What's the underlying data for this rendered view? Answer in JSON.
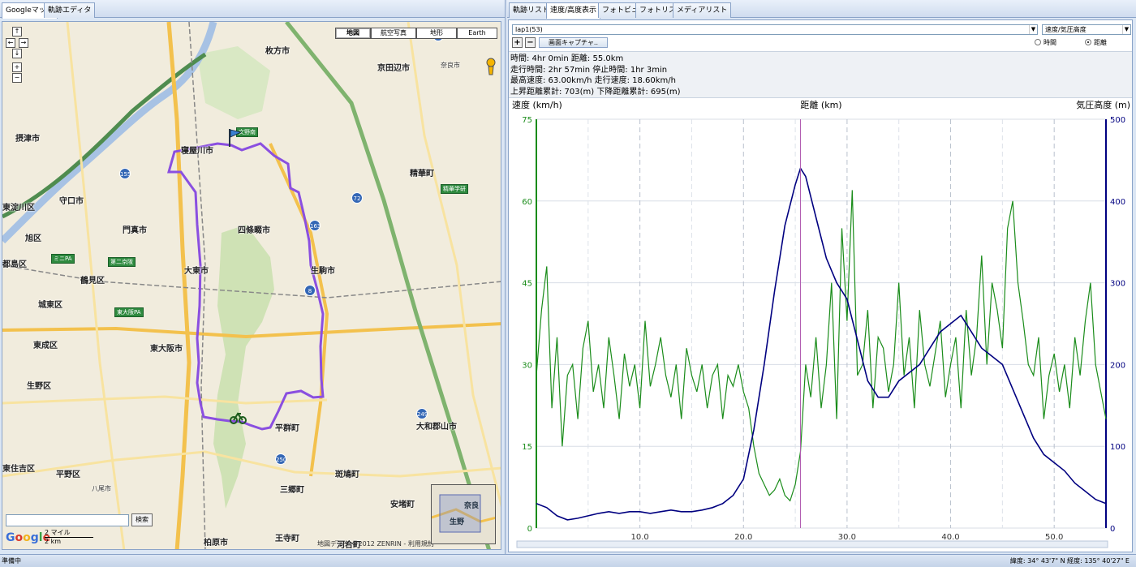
{
  "left_tabs": [
    "Googleマップ",
    "軌跡エディタ"
  ],
  "right_tabs": [
    "軌跡リスト",
    "速度/高度表示",
    "フォトビュー",
    "フォトリスト",
    "メディアリスト"
  ],
  "map": {
    "types": [
      "地図",
      "航空写真",
      "地形",
      "Earth"
    ],
    "search_button": "検索",
    "google_logo": "Google",
    "scale": {
      "top": "2 マイル",
      "bottom": "2 km"
    },
    "copyright": "地図データ ©2012 ZENRIN - 利用規約",
    "overview_labels": [
      "奈良",
      "生野"
    ],
    "places": [
      {
        "text": "枚方市"
      },
      {
        "text": "京田辺市"
      },
      {
        "text": "寝屋川市"
      },
      {
        "text": "摂津市"
      },
      {
        "text": "守口市"
      },
      {
        "text": "門真市"
      },
      {
        "text": "四條畷市"
      },
      {
        "text": "精華町"
      },
      {
        "text": "大東市"
      },
      {
        "text": "生駒市"
      },
      {
        "text": "鶴見区"
      },
      {
        "text": "城東区"
      },
      {
        "text": "東成区"
      },
      {
        "text": "東大阪市"
      },
      {
        "text": "生野区"
      },
      {
        "text": "平群町"
      },
      {
        "text": "大和郡山市"
      },
      {
        "text": "平野区"
      },
      {
        "text": "東住吉区"
      },
      {
        "text": "三郷町"
      },
      {
        "text": "斑鳩町"
      },
      {
        "text": "安堵町"
      },
      {
        "text": "柏原市"
      },
      {
        "text": "王寺町"
      },
      {
        "text": "河合町"
      },
      {
        "text": "旭区"
      },
      {
        "text": "東淀川区"
      },
      {
        "text": "都島区"
      },
      {
        "text": "八尾市"
      },
      {
        "text": "奈良市"
      }
    ]
  },
  "panel": {
    "track_select": "lap1(53)",
    "axis_select": "速度/気圧高度",
    "capture_button": "画面キャプチャ..",
    "radio_time": "時間",
    "radio_distance": "距離",
    "stats": [
      "時間: 4hr 0min  距離: 55.0km",
      "走行時間: 2hr 57min  停止時間: 1hr 3min",
      "最高速度: 63.00km/h  走行速度: 18.60km/h",
      "上昇距離累計: 703(m)  下降距離累計: 695(m)"
    ]
  },
  "chart_data": {
    "type": "line",
    "xlabel": "距離 (km)",
    "ylabel_left": "速度 (km/h)",
    "ylabel_right": "気圧高度 (m)",
    "x_ticks": [
      10.0,
      20.0,
      30.0,
      40.0,
      50.0
    ],
    "left_ticks": [
      0,
      15,
      30,
      45,
      60,
      75
    ],
    "right_ticks": [
      0,
      100,
      200,
      300,
      400,
      500
    ],
    "xlim": [
      0,
      55
    ],
    "ylim_left": [
      0,
      75
    ],
    "ylim_right": [
      0,
      500
    ],
    "cursor_x": 25.5,
    "colors": {
      "speed": "#1a8c1a",
      "altitude": "#000080",
      "cursor": "#b05ab0",
      "left_axis": "#1a8c1a",
      "right_axis": "#000080"
    },
    "series": [
      {
        "name": "速度",
        "axis": "left",
        "x": [
          0,
          0.5,
          1,
          1.5,
          2,
          2.5,
          3,
          3.5,
          4,
          4.5,
          5,
          5.5,
          6,
          6.5,
          7,
          7.5,
          8,
          8.5,
          9,
          9.5,
          10,
          10.5,
          11,
          11.5,
          12,
          12.5,
          13,
          13.5,
          14,
          14.5,
          15,
          15.5,
          16,
          16.5,
          17,
          17.5,
          18,
          18.5,
          19,
          19.5,
          20,
          20.5,
          21,
          21.5,
          22,
          22.5,
          23,
          23.5,
          24,
          24.5,
          25,
          25.5,
          26,
          26.5,
          27,
          27.5,
          28,
          28.5,
          29,
          29.5,
          30,
          30.5,
          31,
          31.5,
          32,
          32.5,
          33,
          33.5,
          34,
          34.5,
          35,
          35.5,
          36,
          36.5,
          37,
          37.5,
          38,
          38.5,
          39,
          39.5,
          40,
          40.5,
          41,
          41.5,
          42,
          42.5,
          43,
          43.5,
          44,
          44.5,
          45,
          45.5,
          46,
          46.5,
          47,
          47.5,
          48,
          48.5,
          49,
          49.5,
          50,
          50.5,
          51,
          51.5,
          52,
          52.5,
          53,
          53.5,
          54,
          54.5,
          55
        ],
        "values": [
          28,
          40,
          48,
          22,
          35,
          15,
          28,
          30,
          20,
          33,
          38,
          25,
          30,
          22,
          35,
          28,
          20,
          32,
          26,
          30,
          22,
          38,
          26,
          30,
          35,
          28,
          24,
          30,
          20,
          33,
          28,
          25,
          30,
          22,
          28,
          30,
          20,
          28,
          26,
          30,
          25,
          22,
          15,
          10,
          8,
          6,
          7,
          9,
          6,
          5,
          8,
          14,
          30,
          24,
          35,
          22,
          30,
          45,
          20,
          55,
          38,
          62,
          28,
          30,
          40,
          22,
          35,
          33,
          25,
          30,
          45,
          28,
          35,
          22,
          40,
          30,
          26,
          32,
          38,
          24,
          30,
          35,
          22,
          40,
          28,
          35,
          50,
          30,
          45,
          40,
          33,
          55,
          60,
          45,
          38,
          30,
          28,
          35,
          20,
          28,
          32,
          25,
          30,
          22,
          35,
          28,
          38,
          45,
          30,
          25,
          20
        ]
      },
      {
        "name": "気圧高度",
        "axis": "right",
        "x": [
          0,
          1,
          2,
          3,
          4,
          5,
          6,
          7,
          8,
          9,
          10,
          11,
          12,
          13,
          14,
          15,
          16,
          17,
          18,
          19,
          20,
          21,
          22,
          23,
          24,
          25,
          25.5,
          26,
          27,
          28,
          29,
          30,
          31,
          32,
          33,
          34,
          35,
          36,
          37,
          38,
          39,
          40,
          41,
          42,
          43,
          44,
          45,
          46,
          47,
          48,
          49,
          50,
          51,
          52,
          53,
          54,
          55
        ],
        "values": [
          30,
          25,
          15,
          10,
          12,
          15,
          18,
          20,
          18,
          20,
          20,
          18,
          20,
          22,
          20,
          20,
          22,
          25,
          30,
          40,
          60,
          120,
          200,
          290,
          370,
          420,
          440,
          430,
          380,
          330,
          300,
          280,
          230,
          180,
          160,
          160,
          180,
          190,
          200,
          220,
          240,
          250,
          260,
          240,
          220,
          210,
          200,
          170,
          140,
          110,
          90,
          80,
          70,
          55,
          45,
          35,
          30
        ]
      }
    ]
  },
  "status": {
    "text": "準備中",
    "coords": "緯度: 34° 43'7\" N  経度: 135° 40'27\" E"
  }
}
